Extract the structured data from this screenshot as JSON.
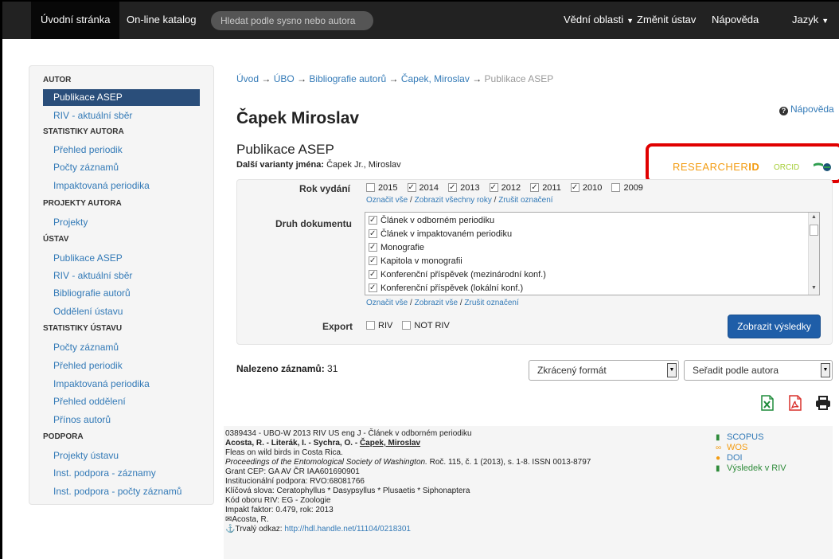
{
  "nav": {
    "home": "Úvodní stránka",
    "catalog": "On-line katalog",
    "search_placeholder": "Hledat podle sysno nebo autora",
    "fields": "Vědní oblasti",
    "change_institute": "Změnit ústav",
    "help": "Nápověda",
    "language": "Jazyk"
  },
  "sidebar": {
    "sections": [
      {
        "heading": "AUTOR",
        "items": [
          "Publikace ASEP",
          "RIV - aktuální sběr"
        ]
      },
      {
        "heading": "STATISTIKY AUTORA",
        "items": [
          "Přehled periodik",
          "Počty záznamů",
          "Impaktovaná periodika"
        ]
      },
      {
        "heading": "PROJEKTY AUTORA",
        "items": [
          "Projekty"
        ]
      },
      {
        "heading": "ÚSTAV",
        "items": [
          "Publikace ASEP",
          "RIV - aktuální sběr",
          "Bibliografie autorů",
          "Oddělení ústavu"
        ]
      },
      {
        "heading": "STATISTIKY ÚSTAVU",
        "items": [
          "Počty záznamů",
          "Přehled periodik",
          "Impaktovaná periodika",
          "Přehled oddělení",
          "Přínos autorů"
        ]
      },
      {
        "heading": "PODPORA",
        "items": [
          "Projekty ústavu",
          "Inst. podpora - záznamy",
          "Inst. podpora - počty záznamů"
        ]
      }
    ]
  },
  "breadcrumb": {
    "items": [
      "Úvod",
      "ÚBO",
      "Bibliografie autorů",
      "Čapek, Miroslav"
    ],
    "current": "Publikace ASEP",
    "sep": "→"
  },
  "page": {
    "title": "Čapek Miroslav",
    "help": "Nápověda",
    "subtitle": "Publikace ASEP",
    "variants_label": "Další varianty jména:",
    "variants_value": "Čapek Jr., Miroslav"
  },
  "logos": {
    "researcherid_a": "RESEARCHER",
    "researcherid_b": "ID",
    "orcid": "ORCID"
  },
  "filter": {
    "year_label": "Rok vydání",
    "years": [
      {
        "label": "2015",
        "checked": false
      },
      {
        "label": "2014",
        "checked": true
      },
      {
        "label": "2013",
        "checked": true
      },
      {
        "label": "2012",
        "checked": true
      },
      {
        "label": "2011",
        "checked": true
      },
      {
        "label": "2010",
        "checked": true
      },
      {
        "label": "2009",
        "checked": false
      }
    ],
    "year_links": [
      "Označit vše",
      "Zobrazit všechny roky",
      "Zrušit označení"
    ],
    "doc_label": "Druh dokumentu",
    "docs": [
      "Článek v odborném periodiku",
      "Článek v impaktovaném periodiku",
      "Monografie",
      "Kapitola v monografii",
      "Konferenční příspěvek (mezinárodní konf.)",
      "Konferenční příspěvek (lokální konf.)"
    ],
    "doc_links": [
      "Označit vše",
      "Zobrazit vše",
      "Zrušit označení"
    ],
    "link_sep": "/",
    "export_label": "Export",
    "export_riv": "RIV",
    "export_notriv": "NOT RIV",
    "submit": "Zobrazit výsledky"
  },
  "results": {
    "found_label": "Nalezeno záznamů:",
    "found_count": "31",
    "format_select": "Zkrácený formát",
    "sort_select": "Seřadit podle autora"
  },
  "record": {
    "line1": "0389434 - UBO-W 2013 RIV US eng J - Článek v odborném periodiku",
    "authors_pre": "Acosta, R. - Literák, I. - Sychra, O. - ",
    "authors_main": "Čapek, Miroslav",
    "title": "Fleas on wild birds in Costa Rica.",
    "journal": "Proceedings of the Entomological Society of Washington.",
    "journal_rest": " Roč. 115, č. 1 (2013), s. 1-8. ISSN 0013-8797",
    "grant": "Grant CEP: GA AV ČR IAA601690901",
    "inst": "Institucionální podpora: RVO:68081766",
    "keywords": "Klíčová slova: Ceratophyllus * Dasypsyllus * Plusaetis * Siphonaptera",
    "riv": "Kód oboru RIV: EG - Zoologie",
    "impact": "Impakt faktor: 0.479, rok: 2013",
    "contact": "Acosta, R.",
    "permalink_label": "Trvalý odkaz: ",
    "permalink": "http://hdl.handle.net/11104/0218301",
    "links": {
      "scopus": "SCOPUS",
      "wos": "WOS",
      "doi": "DOI",
      "riv": "Výsledek v RIV"
    }
  },
  "colors": {
    "navbar": "#222222",
    "link": "#337ab7",
    "active": "#2a4e7a",
    "button": "#1f5ea8",
    "highlight": "#e00000",
    "researcherid": "#f39c12",
    "orcid": "#a6ce39"
  }
}
